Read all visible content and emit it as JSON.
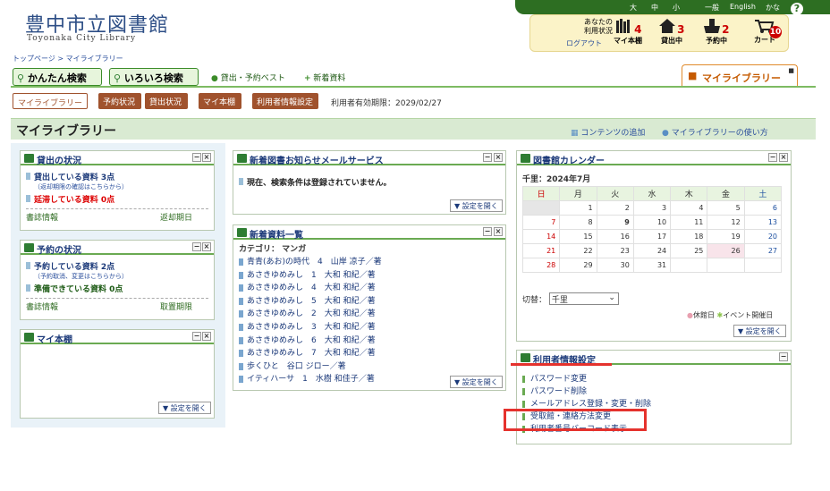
{
  "header": {
    "title": "豊中市立図書館",
    "subtitle": "Toyonaka City Library",
    "font_large": "大",
    "font_medium": "中",
    "font_small": "小",
    "lang_general": "一般",
    "lang_english": "English",
    "lang_kana": "かな",
    "help": "?"
  },
  "userbox": {
    "status_line1": "あなたの",
    "status_line2": "利用状況",
    "logout": "ログアウト",
    "myshelf_label": "マイ本棚",
    "myshelf_count": "4",
    "lending_label": "貸出中",
    "lending_count": "3",
    "reserve_label": "予約中",
    "reserve_count": "2",
    "cart_label": "カート",
    "cart_count": "10"
  },
  "breadcrumb": "トップページ > マイライブラリー",
  "tabs": {
    "simple_search": "かんたん検索",
    "advanced_search": "いろいろ検索",
    "best": "貸出・予約ベスト",
    "new": "新着資料",
    "mylibrary": "マイライブラリー"
  },
  "subnav": {
    "mylibrary": "マイライブラリー",
    "reserve_status": "予約状況",
    "lending_status": "貸出状況",
    "myshelf": "マイ本棚",
    "user_settings": "利用者情報設定",
    "expiry": "利用者有効期限：2029/02/27"
  },
  "main": {
    "title": "マイライブラリー",
    "add_content": "コンテンツの追加",
    "howto": "マイライブラリーの使い方"
  },
  "lending": {
    "title": "貸出の状況",
    "lent_items": "貸出している資料 3点",
    "lent_note": "（返却期限の確認はこちらから）",
    "overdue": "延滞している資料 0点",
    "foot_left": "書誌情報",
    "foot_right": "返却期日"
  },
  "reserve": {
    "title": "予約の状況",
    "reserved": "予約している資料 2点",
    "reserved_note": "（予約取消、変更はこちらから）",
    "ready": "準備できている資料 0点",
    "foot_left": "書誌情報",
    "foot_right": "取置期限"
  },
  "myshelf": {
    "title": "マイ本棚",
    "settings": "▼ 設定を開く"
  },
  "mail": {
    "title": "新着図書お知らせメールサービス",
    "message": "現在、検索条件は登録されていません。",
    "settings": "▼ 設定を開く"
  },
  "newbooks": {
    "title": "新着資料一覧",
    "category": "カテゴリ： マンガ",
    "items": [
      "青青(あお)の時代　4　山岸 凉子／著",
      "あさきゆめみし　1　大和 和紀／著",
      "あさきゆめみし　4　大和 和紀／著",
      "あさきゆめみし　5　大和 和紀／著",
      "あさきゆめみし　2　大和 和紀／著",
      "あさきゆめみし　3　大和 和紀／著",
      "あさきゆめみし　6　大和 和紀／著",
      "あさきゆめみし　7　大和 和紀／著",
      "歩くひと　谷口 ジロー／著",
      "イティハーサ　1　水樹 和佳子／著"
    ],
    "settings": "▼ 設定を開く"
  },
  "calendar": {
    "title": "図書館カレンダー",
    "month": "千里：2024年7月",
    "weekdays": [
      "日",
      "月",
      "火",
      "水",
      "木",
      "金",
      "土"
    ],
    "weeks": [
      [
        "",
        "1",
        "2",
        "3",
        "4",
        "5",
        "6"
      ],
      [
        "7",
        "8",
        "9",
        "10",
        "11",
        "12",
        "13"
      ],
      [
        "14",
        "15",
        "16",
        "17",
        "18",
        "19",
        "20"
      ],
      [
        "21",
        "22",
        "23",
        "24",
        "25",
        "26",
        "27"
      ],
      [
        "28",
        "29",
        "30",
        "31",
        "",
        "",
        ""
      ]
    ],
    "switch_label": "切替：",
    "switch_value": "千里",
    "legend_closed": "休館日",
    "legend_event": "イベント開催日",
    "settings": "▼ 設定を開く"
  },
  "userinfo": {
    "title": "利用者情報設定",
    "items": [
      "パスワード変更",
      "パスワード削除",
      "メールアドレス登録・変更・削除",
      "受取館・連絡方法変更",
      "利用者番号バーコード表示"
    ]
  },
  "colors": {
    "highlight": "#e5322d",
    "brand_green": "#2d6e22",
    "title_blue": "#2d4e86"
  }
}
